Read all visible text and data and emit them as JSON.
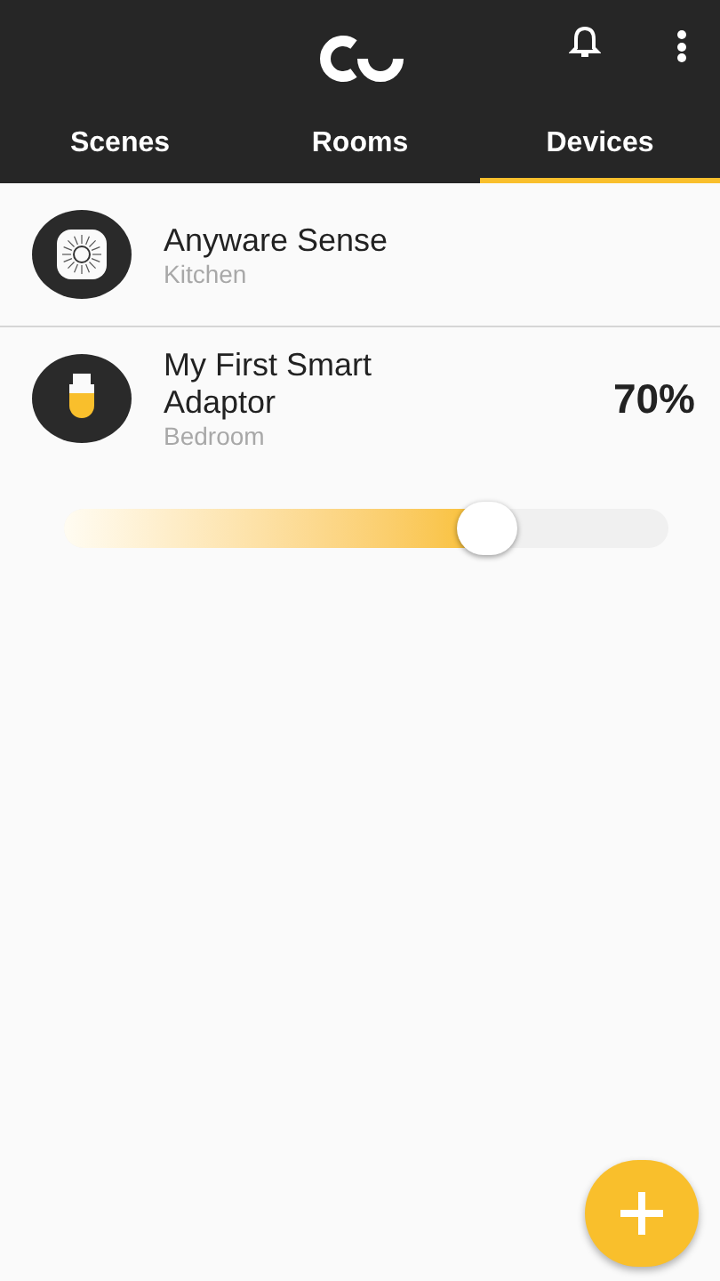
{
  "tabs": [
    {
      "label": "Scenes",
      "selected": false
    },
    {
      "label": "Rooms",
      "selected": false
    },
    {
      "label": "Devices",
      "selected": true
    }
  ],
  "devices": [
    {
      "kind": "sensor",
      "name": "Anyware Sense",
      "room": "Kitchen"
    },
    {
      "kind": "adaptor",
      "name": "My First Smart Adaptor",
      "room": "Bedroom",
      "reading": "70%",
      "level": 0.7
    }
  ]
}
